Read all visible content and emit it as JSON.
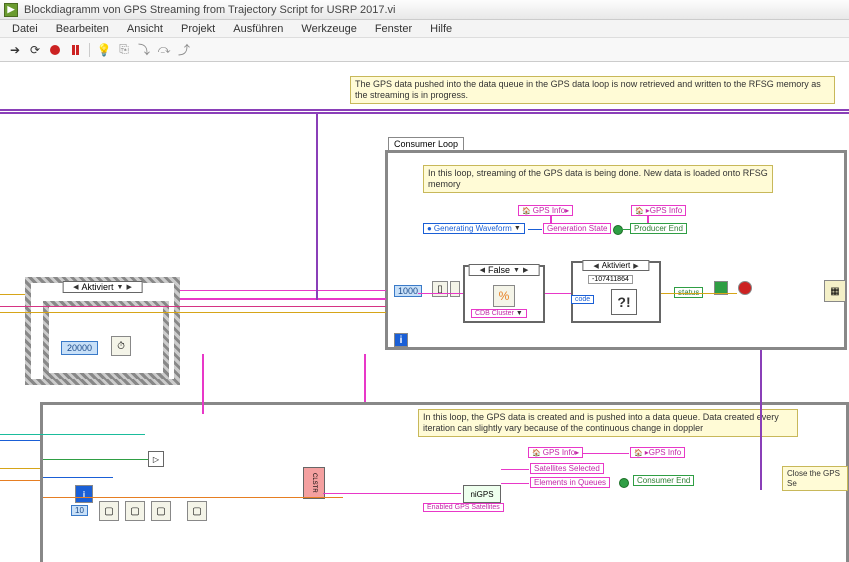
{
  "window": {
    "title": "Blockdiagramm von GPS Streaming from Trajectory Script for USRP 2017.vi"
  },
  "menu": {
    "items": [
      "Datei",
      "Bearbeiten",
      "Ansicht",
      "Projekt",
      "Ausführen",
      "Werkzeuge",
      "Fenster",
      "Hilfe"
    ]
  },
  "comments": {
    "top": "The GPS data pushed into the data queue in the GPS data loop is now retrieved and written to the RFSG memory as the streaming is in progress.",
    "consumer": "In this loop, streaming of the GPS data is being done. New data is loaded onto RFSG memory",
    "producer": "In this loop, the GPS data is created and is pushed into a data queue. Data created every iteration can slightly vary because of the continuous change in doppler",
    "close": "Close the GPS Se"
  },
  "loops": {
    "consumer_label": "Consumer Loop"
  },
  "tags": {
    "gps_info_in": "▸GPS Info",
    "gps_info_out": "GPS Info▸",
    "gen_waveform": "Generating Waveform",
    "gen_state": "Generation State",
    "producer_end": "Producer End",
    "consumer_end": "Consumer End",
    "sat_selected": "Satellites Selected",
    "elem_queues": "Elements in Queues",
    "status": "status",
    "code": "code",
    "nigps": "niGPS",
    "enabled_sats": "Enabled GPS Satellites"
  },
  "case_headers": {
    "aktiviert": "Aktiviert",
    "false": "False",
    "num": "-107411864",
    "cdb": "CDB Cluster"
  },
  "constants": {
    "twenty_k": "20000",
    "thousand": "1000"
  }
}
